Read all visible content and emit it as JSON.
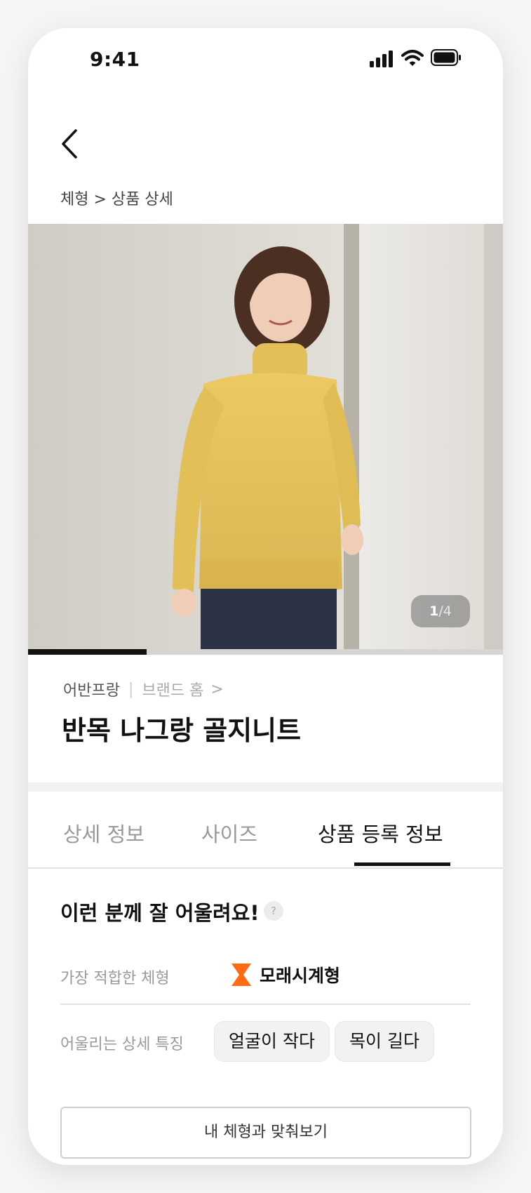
{
  "status_bar": {
    "time": "9:41"
  },
  "breadcrumb": "체형 > 상품 상세",
  "gallery": {
    "current": "1",
    "separator": "/",
    "total": "4",
    "progress_fraction": 0.25
  },
  "brand": {
    "name": "어반프랑",
    "divider": "|",
    "home_link": "브랜드 홈",
    "chevron": ">"
  },
  "product": {
    "title": "반목 나그랑 골지니트"
  },
  "tabs": [
    {
      "label": "상세 정보",
      "active": false
    },
    {
      "label": "사이즈",
      "active": false
    },
    {
      "label": "상품 등록 정보",
      "active": true
    }
  ],
  "fit_section": {
    "title": "이런 분께 잘 어울려요!",
    "help_icon": "?",
    "best_type_label": "가장 적합한 체형",
    "best_type_value": "모래시계형",
    "best_type_icon": "hourglass-icon",
    "features_label": "어울리는 상세 특징",
    "features": [
      "얼굴이 작다",
      "목이 길다"
    ],
    "cta": "내 체형과 맞춰보기"
  },
  "colors": {
    "accent": "#ff6a13",
    "active_tab": "#111111",
    "sweater": "#e8c460"
  }
}
